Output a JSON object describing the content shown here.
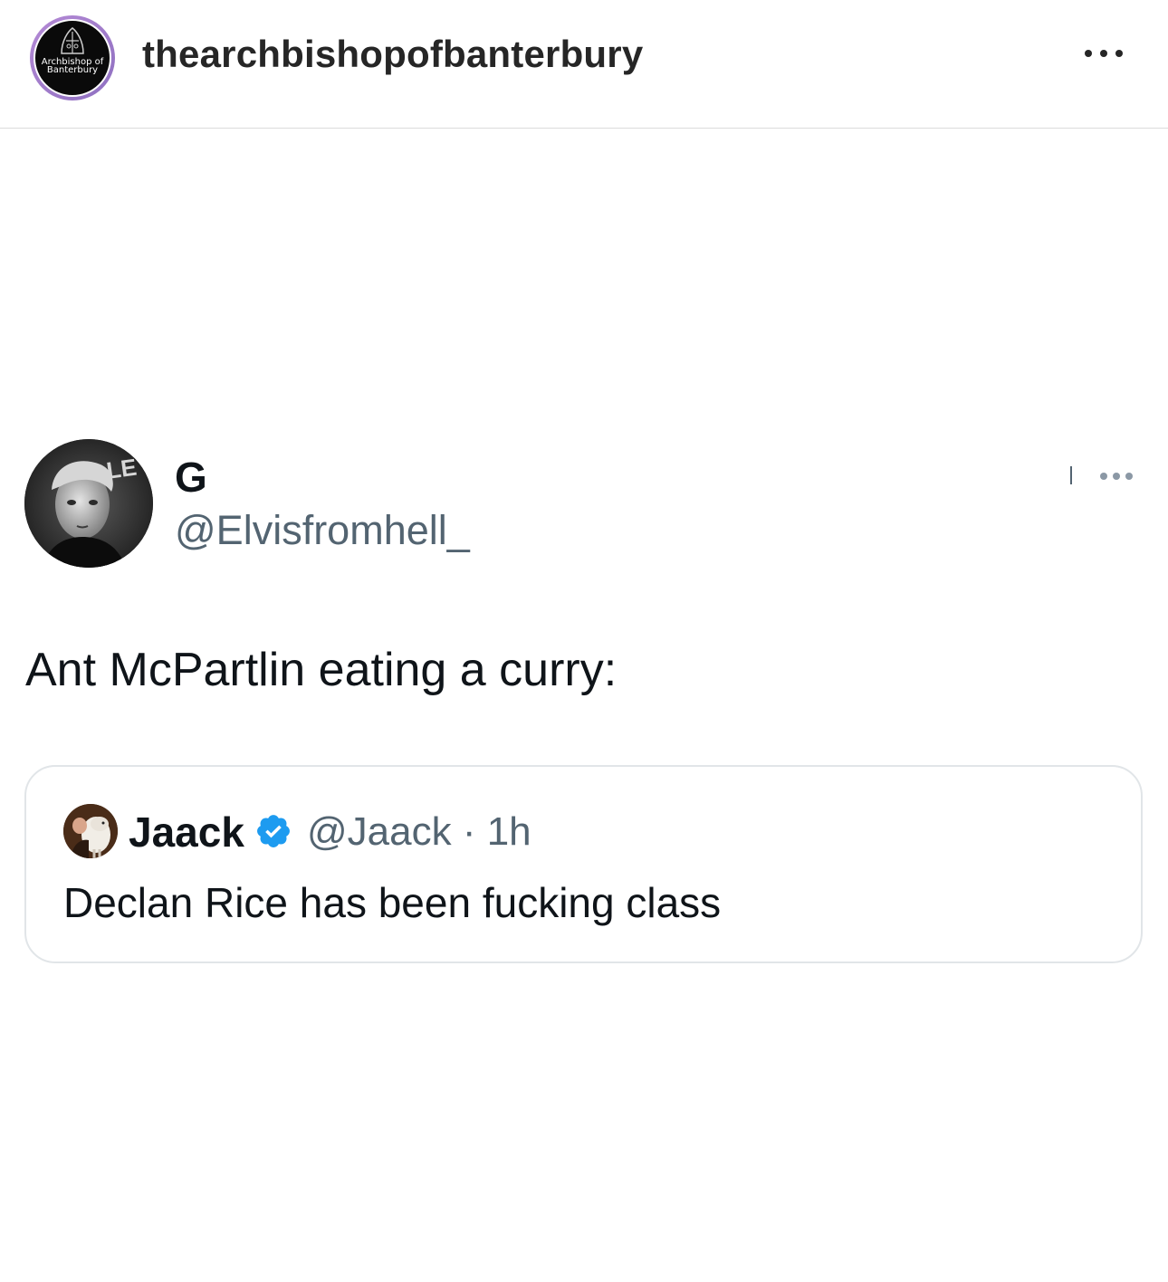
{
  "header": {
    "avatar_text_line1": "Archbishop of",
    "avatar_text_line2": "Banterbury",
    "username": "thearchbishopofbanterbury",
    "more_icon": "more-horizontal-icon"
  },
  "tweet": {
    "author_name": "G",
    "author_handle": "@Elvisfromhell_",
    "text": "Ant McPartlin eating a curry:",
    "more_icon": "more-horizontal-icon"
  },
  "quoted_tweet": {
    "author_name": "Jaack",
    "verified_icon": "verified-badge-icon",
    "meta": "@Jaack · 1h",
    "text": "Declan Rice has been fucking class"
  },
  "colors": {
    "verified_blue": "#1d9bf0",
    "secondary_text": "#536471",
    "primary_text": "#0f1419",
    "avatar_ring": "#a97fd1"
  }
}
